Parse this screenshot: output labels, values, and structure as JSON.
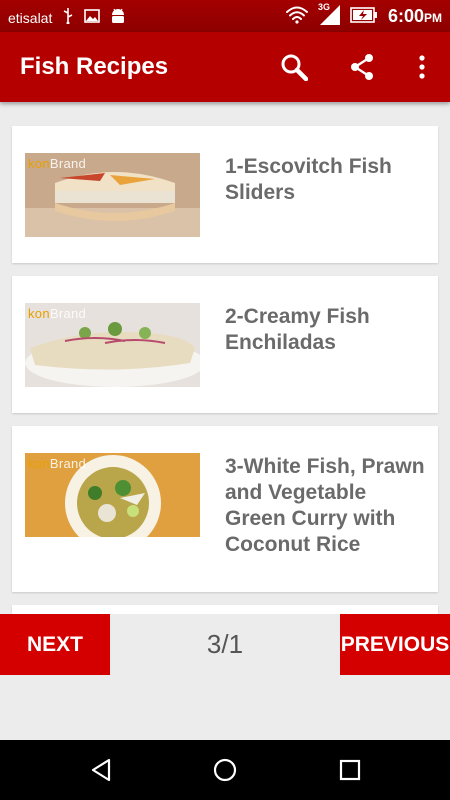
{
  "status_bar": {
    "carrier": "etisalat",
    "network_type": "3G",
    "time": "6:00",
    "time_suffix": "PM",
    "icons": [
      "usb-icon",
      "image-icon",
      "android-icon",
      "wifi-icon",
      "signal-icon",
      "battery-charging-icon"
    ]
  },
  "app_bar": {
    "title": "Fish Recipes",
    "actions": [
      "search-icon",
      "share-icon",
      "overflow-menu-icon"
    ]
  },
  "recipes": [
    {
      "title": "1-Escovitch Fish Sliders",
      "thumb_watermark_a": "kon",
      "thumb_watermark_b": "Brand"
    },
    {
      "title": "2-Creamy Fish Enchiladas",
      "thumb_watermark_a": "kon",
      "thumb_watermark_b": "Brand"
    },
    {
      "title": "3-White Fish, Prawn and Vegetable Green Curry with Coconut Rice",
      "thumb_watermark_a": "kon",
      "thumb_watermark_b": "Brand"
    }
  ],
  "pagination": {
    "next_label": "NEXT",
    "page_indicator": "3/1",
    "previous_label": "PREVIOUS"
  },
  "system_nav": [
    "back-icon",
    "home-icon",
    "recents-icon"
  ],
  "colors": {
    "status_bar": "#9a0000",
    "app_bar": "#b50000",
    "nav_button": "#d40000",
    "recipe_title": "#6a6a6a",
    "background": "#ececec"
  }
}
